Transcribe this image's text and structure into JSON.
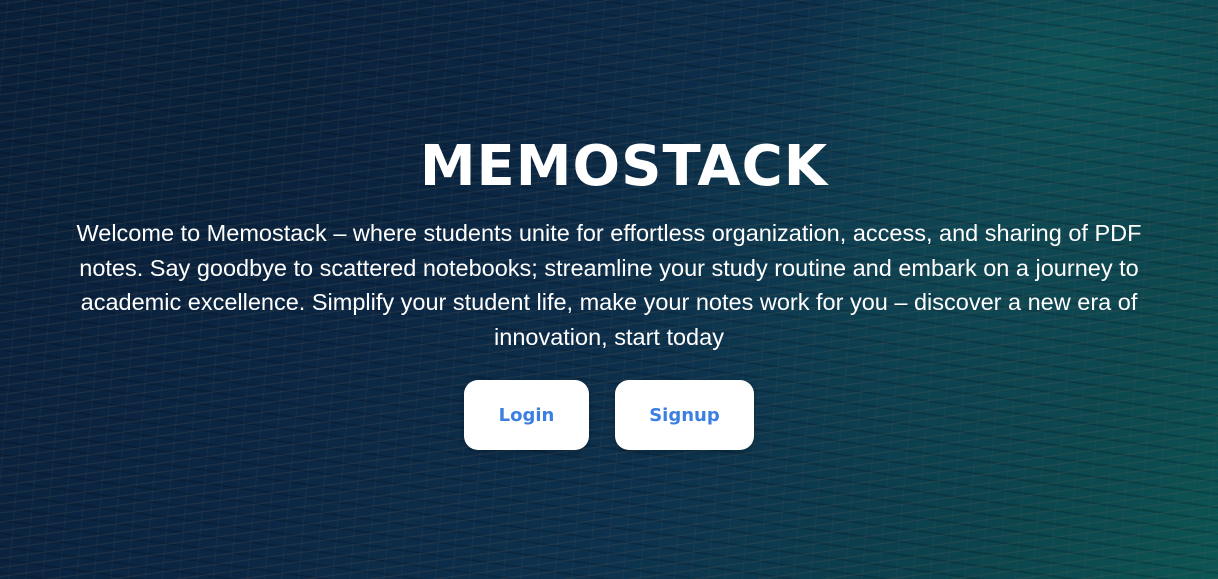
{
  "hero": {
    "title": "MEMOSTACK",
    "description": "Welcome to Memostack – where students unite for effortless organization, access, and sharing of PDF notes. Say goodbye to scattered notebooks; streamline your study routine and embark on a journey to academic excellence. Simplify your student life, make your notes work for you – discover a new era of innovation, start today"
  },
  "actions": {
    "login_label": "Login",
    "signup_label": "Signup"
  },
  "colors": {
    "button_text": "#3b7fe0",
    "button_bg": "#ffffff",
    "title_text": "#ffffff"
  }
}
